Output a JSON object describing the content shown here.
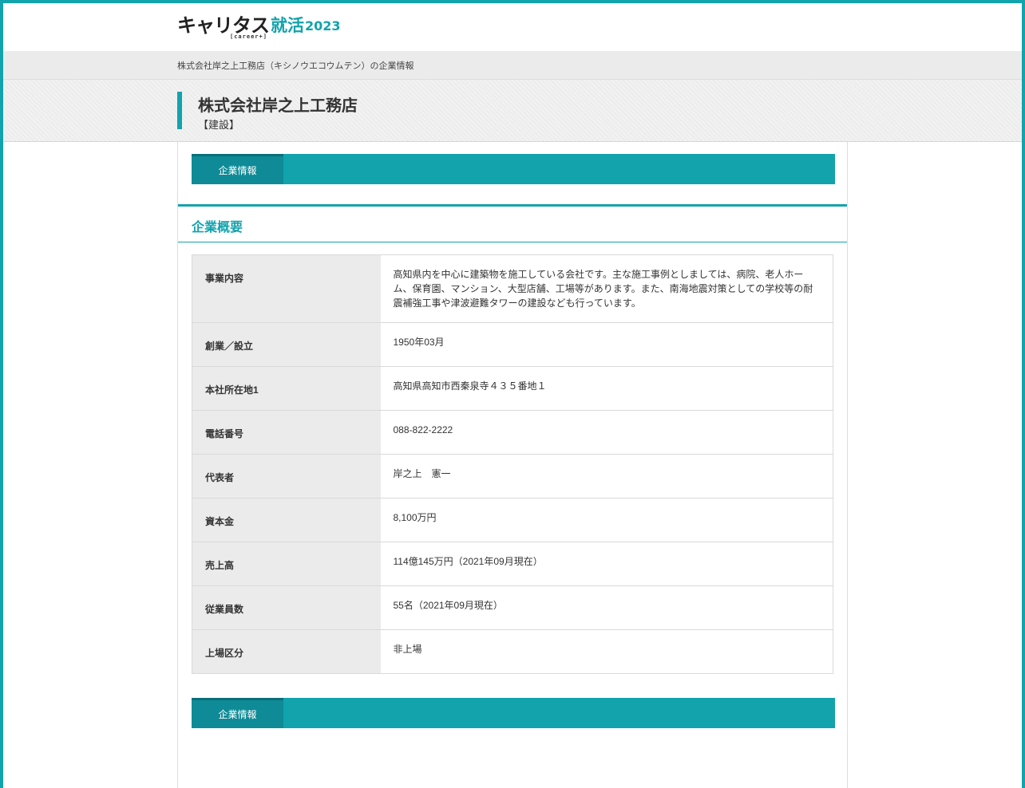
{
  "header": {
    "logo_main": "キャリタス",
    "logo_accent": "就活",
    "logo_year": "2023",
    "logo_sub": "[career+]"
  },
  "breadcrumb": "株式会社岸之上工務店（キシノウエコウムテン）の企業情報",
  "company": {
    "name": "株式会社岸之上工務店",
    "industry": "【建設】"
  },
  "tabs_top": {
    "label": "企業情報"
  },
  "section": {
    "title": "企業概要"
  },
  "rows": [
    {
      "key": "事業内容",
      "value": "高知県内を中心に建築物を施工している会社です。主な施工事例としましては、病院、老人ホーム、保育園、マンション、大型店舗、工場等があります。また、南海地震対策としての学校等の耐震補強工事や津波避難タワーの建設なども行っています。"
    },
    {
      "key": "創業／設立",
      "value": "1950年03月"
    },
    {
      "key": "本社所在地1",
      "value": "高知県高知市西秦泉寺４３５番地１"
    },
    {
      "key": "電話番号",
      "value": "088-822-2222"
    },
    {
      "key": "代表者",
      "value": "岸之上　憲一"
    },
    {
      "key": "資本金",
      "value": "8,100万円"
    },
    {
      "key": "売上高",
      "value": "114億145万円（2021年09月現在）"
    },
    {
      "key": "従業員数",
      "value": "55名（2021年09月現在）"
    },
    {
      "key": "上場区分",
      "value": "非上場"
    }
  ],
  "tabs_bottom": {
    "label": "企業情報"
  },
  "colors": {
    "accent": "#12a3ad",
    "tab_active": "#0e8b96",
    "key_bg": "#ebebeb"
  }
}
